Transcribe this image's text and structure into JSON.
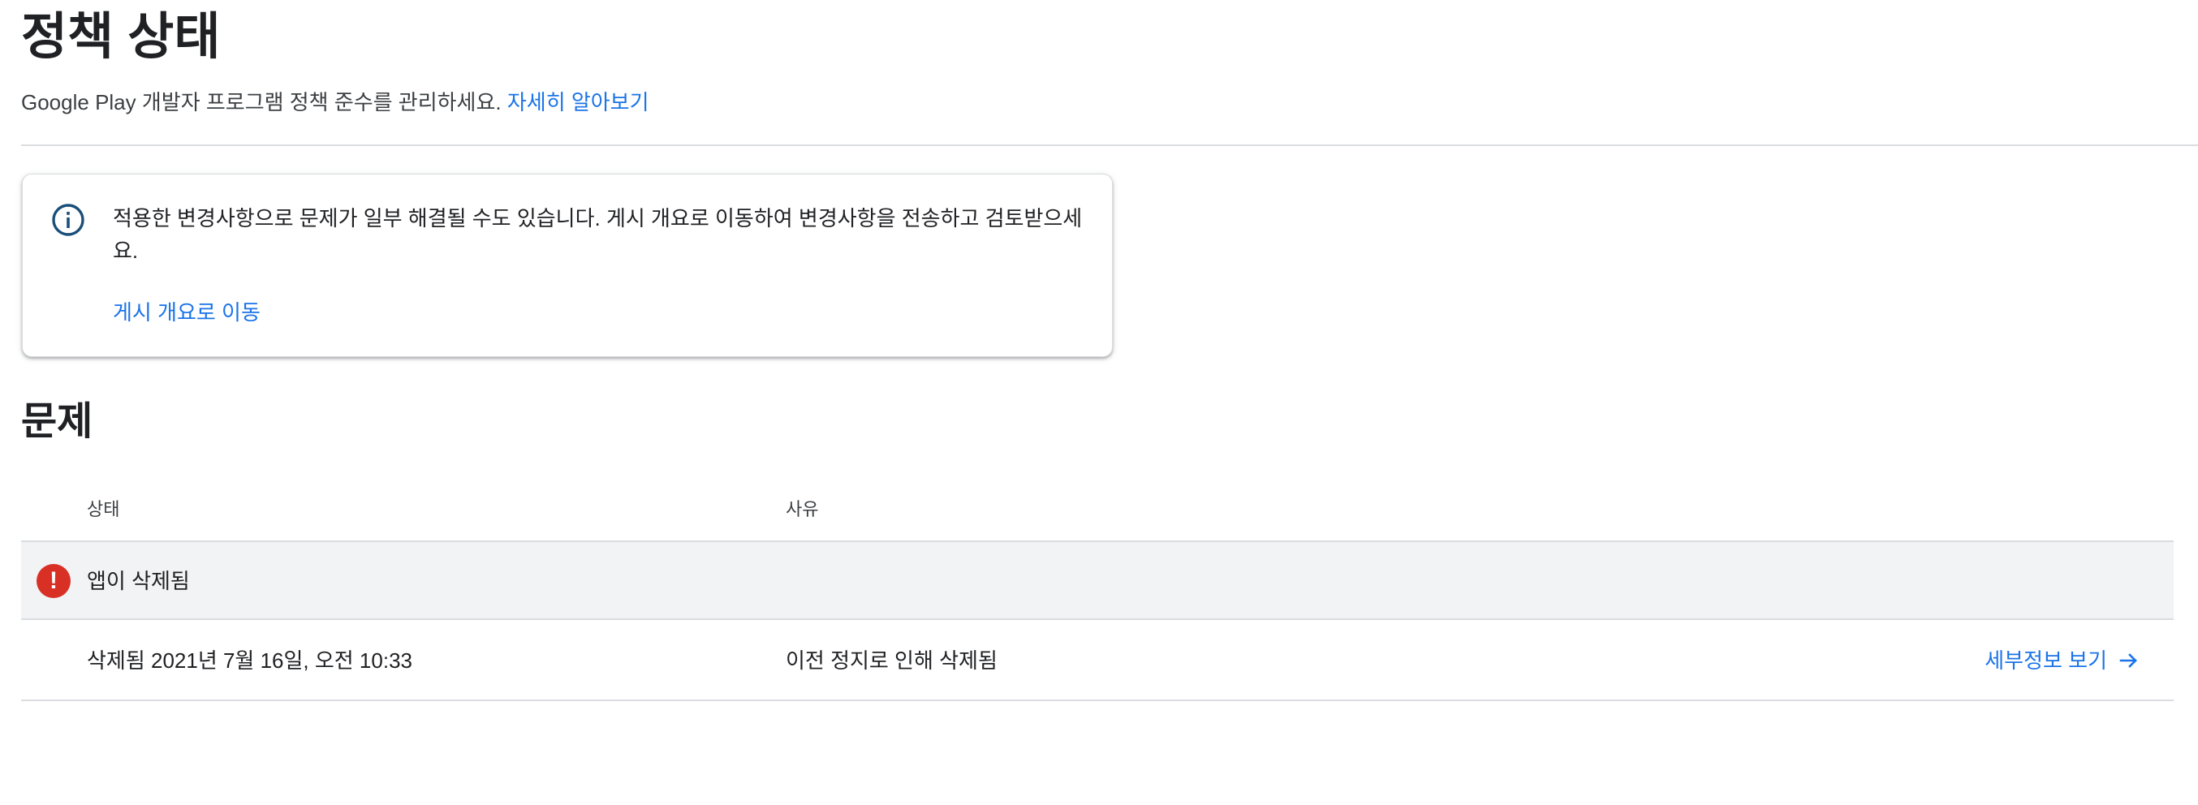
{
  "header": {
    "title": "정책 상태",
    "subtitle": "Google Play 개발자 프로그램 정책 준수를 관리하세요.",
    "learn_more_link": "자세히 알아보기"
  },
  "info_card": {
    "icon": "info-icon",
    "message": "적용한 변경사항으로 문제가 일부 해결될 수도 있습니다. 게시 개요로 이동하여 변경사항을 전송하고 검토받으세요.",
    "action_link": "게시 개요로 이동"
  },
  "issues": {
    "title": "문제",
    "columns": {
      "status": "상태",
      "reason": "사유"
    },
    "groups": [
      {
        "icon": "error-icon",
        "icon_glyph": "!",
        "label": "앱이 삭제됨",
        "rows": [
          {
            "status": "삭제됨 2021년 7월 16일, 오전 10:33",
            "reason": "이전 정지로 인해 삭제됨",
            "details_link": "세부정보 보기"
          }
        ]
      }
    ]
  },
  "colors": {
    "link": "#1a73e8",
    "error": "#d93025",
    "info_icon": "#1a4f7a",
    "group_row_bg": "#f1f3f4",
    "divider": "#dadce0"
  }
}
